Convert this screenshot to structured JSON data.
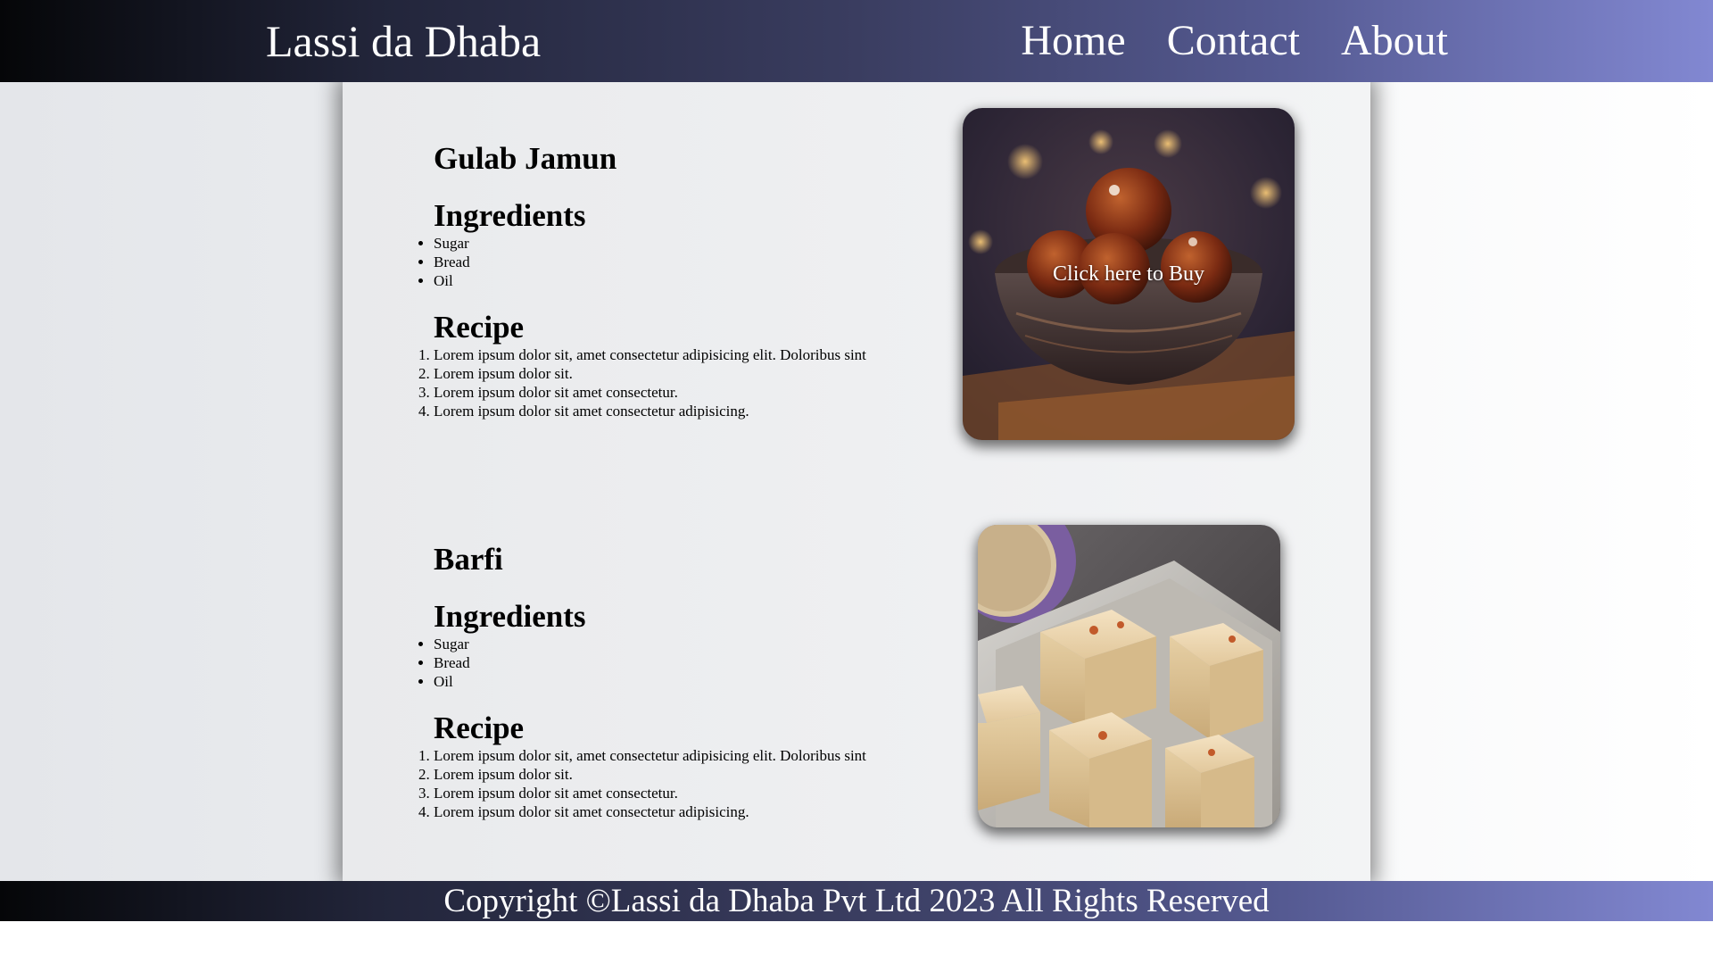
{
  "header": {
    "brand": "Lassi da Dhaba",
    "nav": [
      "Home",
      "Contact",
      "About"
    ]
  },
  "dishes": [
    {
      "title": "Gulab Jamun",
      "ingredients_heading": "Ingredients",
      "ingredients": [
        "Sugar",
        "Bread",
        "Oil"
      ],
      "recipe_heading": "Recipe",
      "recipe": [
        "Lorem ipsum dolor sit, amet consectetur adipisicing elit. Doloribus sint",
        "Lorem ipsum dolor sit.",
        "Lorem ipsum dolor sit amet consectetur.",
        "Lorem ipsum dolor sit amet consectetur adipisicing."
      ],
      "image_overlay": "Click here to Buy",
      "image_icon": "gulab-jamun-photo"
    },
    {
      "title": "Barfi",
      "ingredients_heading": "Ingredients",
      "ingredients": [
        "Sugar",
        "Bread",
        "Oil"
      ],
      "recipe_heading": "Recipe",
      "recipe": [
        "Lorem ipsum dolor sit, amet consectetur adipisicing elit. Doloribus sint",
        "Lorem ipsum dolor sit.",
        "Lorem ipsum dolor sit amet consectetur.",
        "Lorem ipsum dolor sit amet consectetur adipisicing."
      ],
      "image_icon": "barfi-photo"
    }
  ],
  "footer": {
    "copyright": "Copyright ©Lassi da Dhaba Pvt Ltd 2023 All Rights Reserved"
  }
}
